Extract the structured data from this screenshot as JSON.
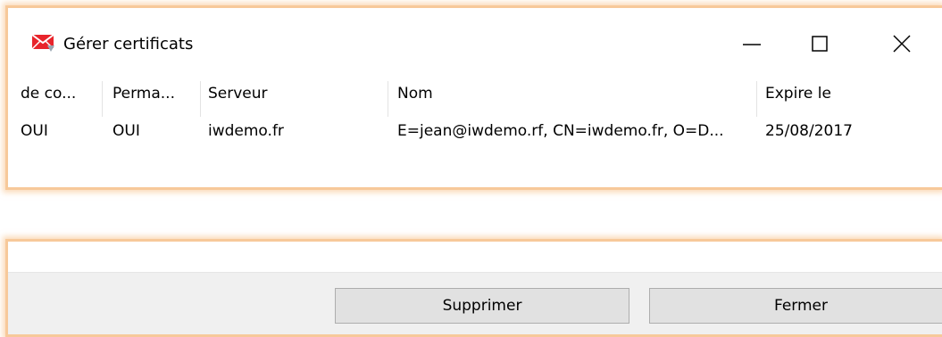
{
  "window": {
    "title": "Gérer certificats",
    "icon": "envelope-certificate-icon",
    "controls": [
      "minimize-icon",
      "maximize-icon",
      "close-icon"
    ]
  },
  "table": {
    "columns": [
      "de co...",
      "Perma...",
      "Serveur",
      "Nom",
      "Expire le"
    ],
    "rows": [
      [
        "OUI",
        "OUI",
        "iwdemo.fr",
        "E=jean@iwdemo.rf, CN=iwdemo.fr, O=D...",
        "25/08/2017"
      ]
    ]
  },
  "buttons": {
    "delete_label": "Supprimer",
    "close_label": "Fermer"
  },
  "colors": {
    "accent_glow": "#f7c99a",
    "icon_red": "#e8242b",
    "button_bg": "#e1e1e1",
    "button_border": "#adadad",
    "footer_bg": "#f0f0f0"
  }
}
